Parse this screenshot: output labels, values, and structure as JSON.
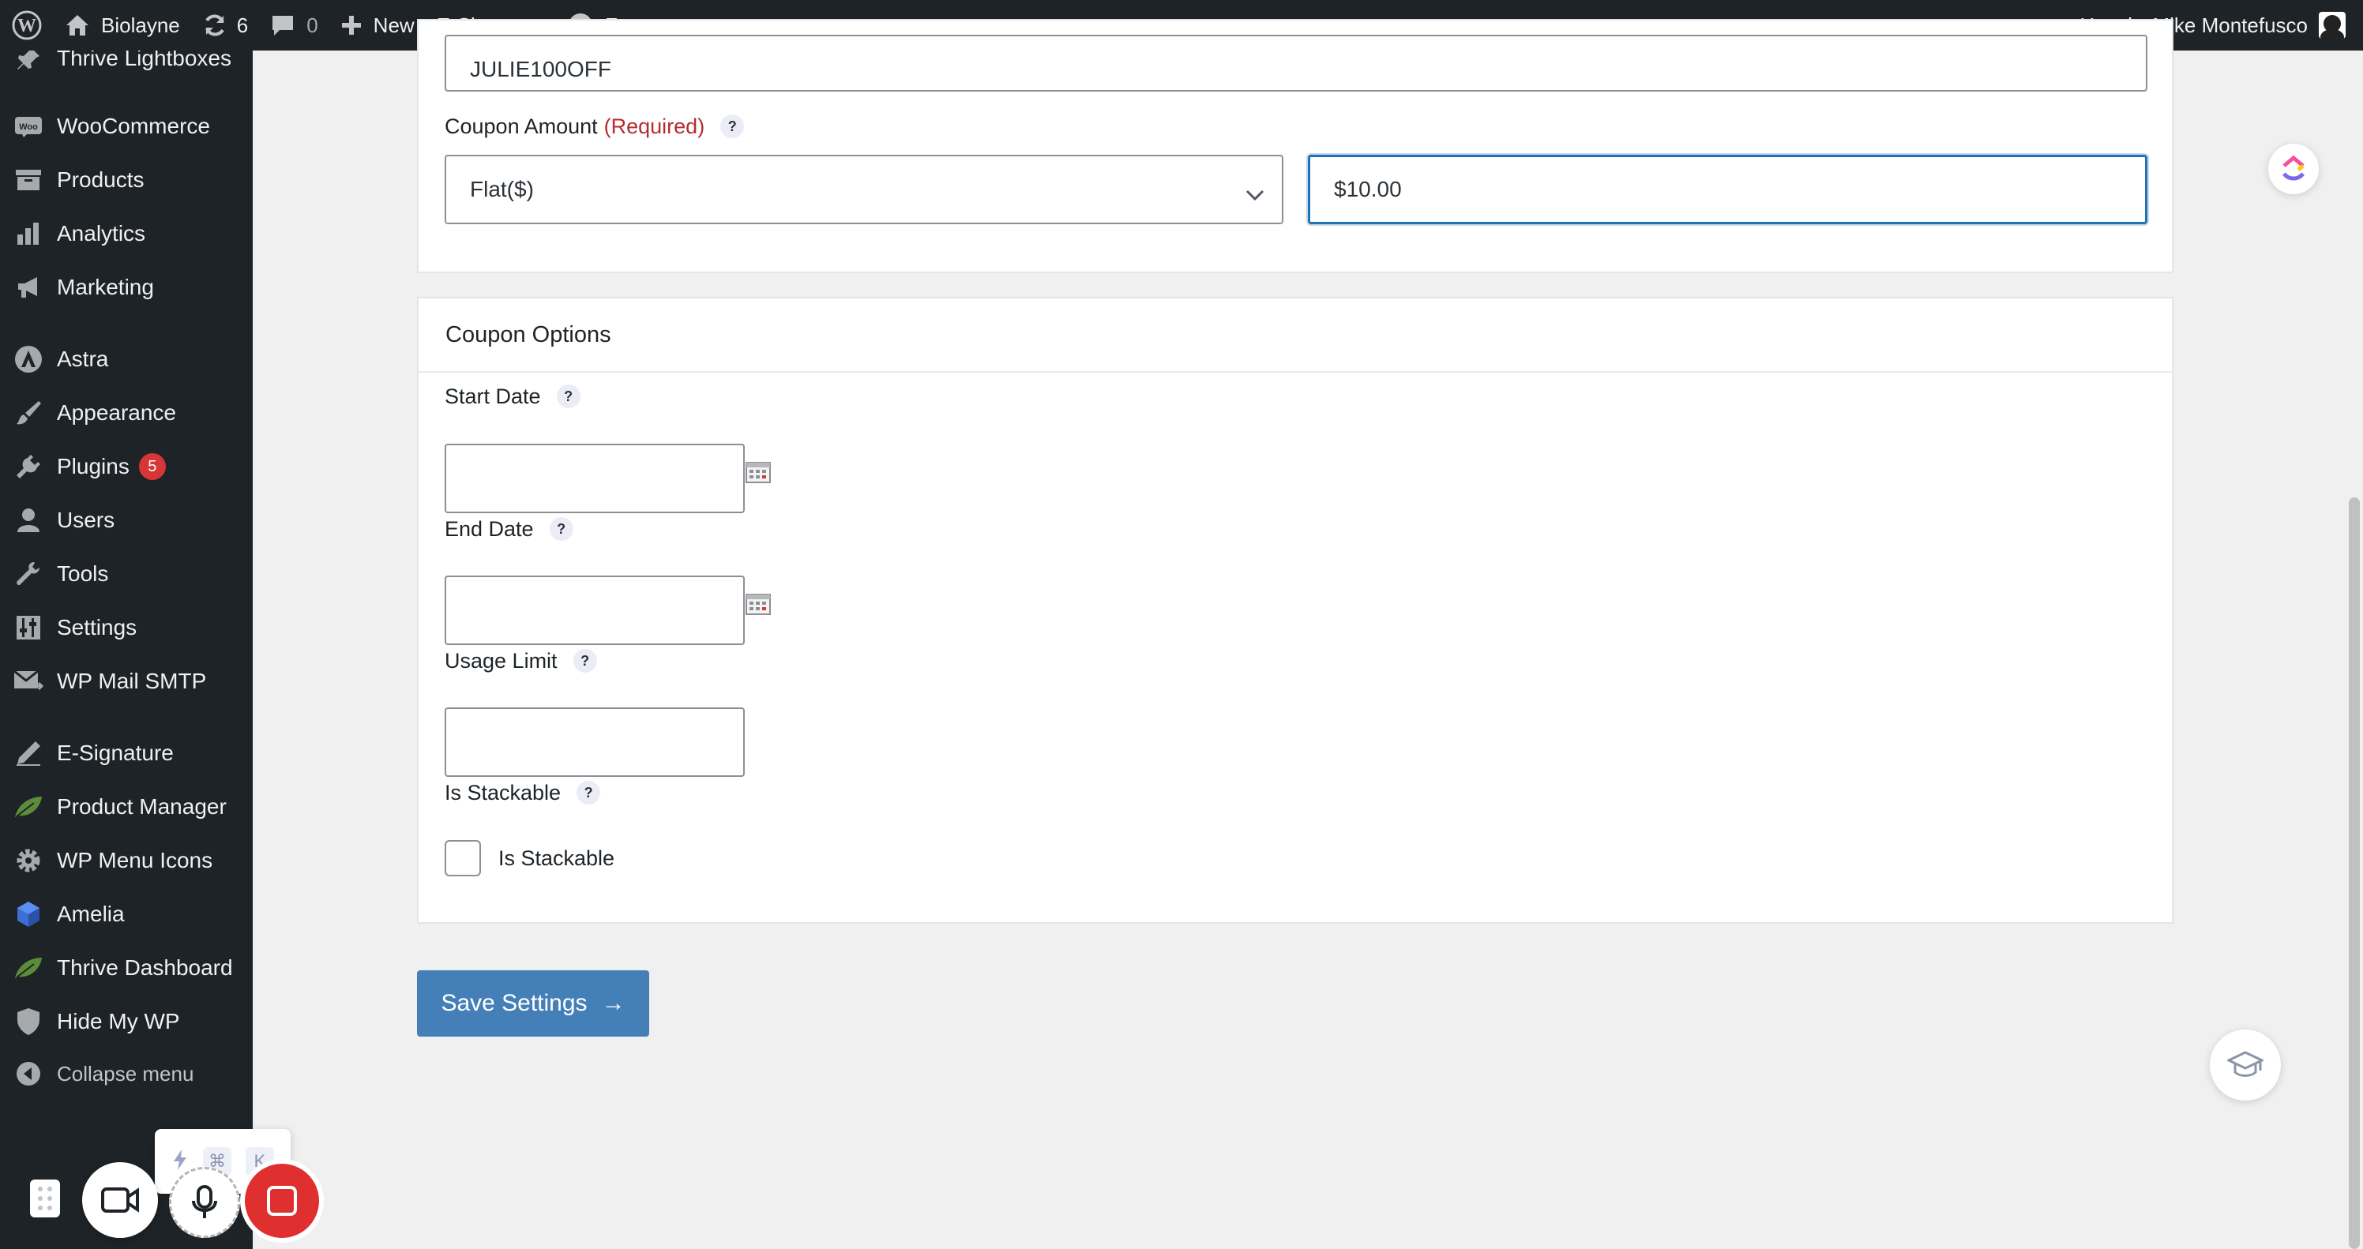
{
  "adminbar": {
    "site_name": "Biolayne",
    "updates_count": "6",
    "comments_count": "0",
    "new_label": "New",
    "esignature_label": "E-Signature",
    "forms_label": "Forms",
    "howdy": "Howdy, Mike Montefusco"
  },
  "sidebar": {
    "items": [
      {
        "label": "Thrive Lightboxes",
        "icon": "pin-icon"
      },
      {
        "label": "WooCommerce",
        "icon": "woo-icon"
      },
      {
        "label": "Products",
        "icon": "archive-icon"
      },
      {
        "label": "Analytics",
        "icon": "bar-chart-icon"
      },
      {
        "label": "Marketing",
        "icon": "megaphone-icon"
      },
      {
        "label": "Astra",
        "icon": "astra-icon"
      },
      {
        "label": "Appearance",
        "icon": "paintbrush-icon"
      },
      {
        "label": "Plugins",
        "icon": "plug-icon",
        "badge": "5"
      },
      {
        "label": "Users",
        "icon": "user-icon"
      },
      {
        "label": "Tools",
        "icon": "wrench-icon"
      },
      {
        "label": "Settings",
        "icon": "sliders-icon"
      },
      {
        "label": "WP Mail SMTP",
        "icon": "mail-icon"
      },
      {
        "label": "E-Signature",
        "icon": "pen-icon"
      },
      {
        "label": "Product Manager",
        "icon": "leaf-icon"
      },
      {
        "label": "WP Menu Icons",
        "icon": "gear-icon"
      },
      {
        "label": "Amelia",
        "icon": "amelia-icon"
      },
      {
        "label": "Thrive Dashboard",
        "icon": "leaf-icon"
      },
      {
        "label": "Hide My WP",
        "icon": "shield-icon"
      }
    ],
    "collapse_label": "Collapse menu"
  },
  "coupon": {
    "code_value": "JULIE100OFF",
    "amount_label": "Coupon Amount",
    "required_label": "(Required)",
    "type_value": "Flat($)",
    "amount_value": "$10.00"
  },
  "options": {
    "title": "Coupon Options",
    "start_date_label": "Start Date",
    "end_date_label": "End Date",
    "usage_limit_label": "Usage Limit",
    "is_stackable_label": "Is Stackable",
    "is_stackable_checkbox_label": "Is Stackable",
    "help_glyph": "?"
  },
  "save_button": {
    "label": "Save Settings",
    "arrow": "→"
  },
  "shortcut": {
    "key1": "⌘",
    "key2": "K"
  },
  "colors": {
    "accent": "#4480b7",
    "focus": "#2271b1",
    "badge": "#d63638",
    "required": "#b32d2e"
  }
}
